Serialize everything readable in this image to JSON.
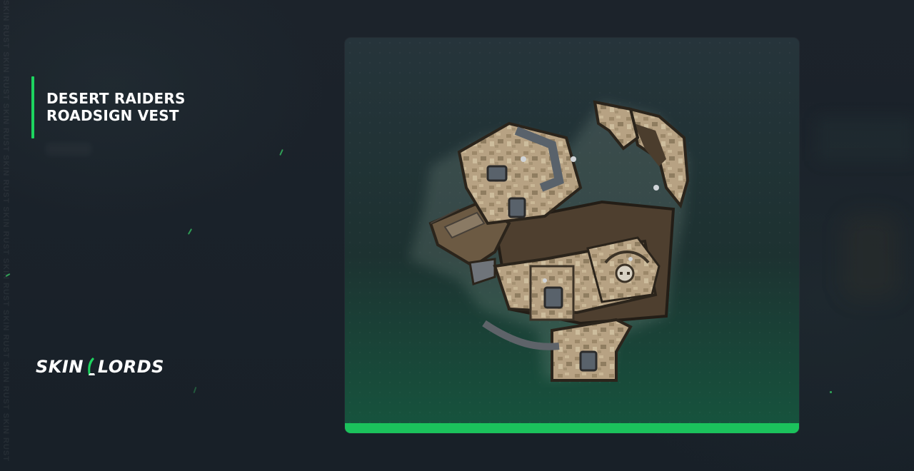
{
  "item": {
    "title_line1": "DESERT RAIDERS",
    "title_line2": "ROADSIGN VEST"
  },
  "brand": {
    "logo_part1": "SKIN",
    "logo_part2": "LORDS",
    "watermark": "SKIN RUST SKIN RUST SKIN RUST SKIN RUST SKIN RUST SKIN RUST SKIN RUST SKIN RUST SKIN RUST"
  },
  "colors": {
    "accent": "#1dd45f",
    "background": "#1a2129",
    "card_bar": "#1bc25c"
  },
  "icons": {
    "logo_mark": "green-claw-icon",
    "item_image": "desert-raiders-roadsign-vest-image"
  }
}
